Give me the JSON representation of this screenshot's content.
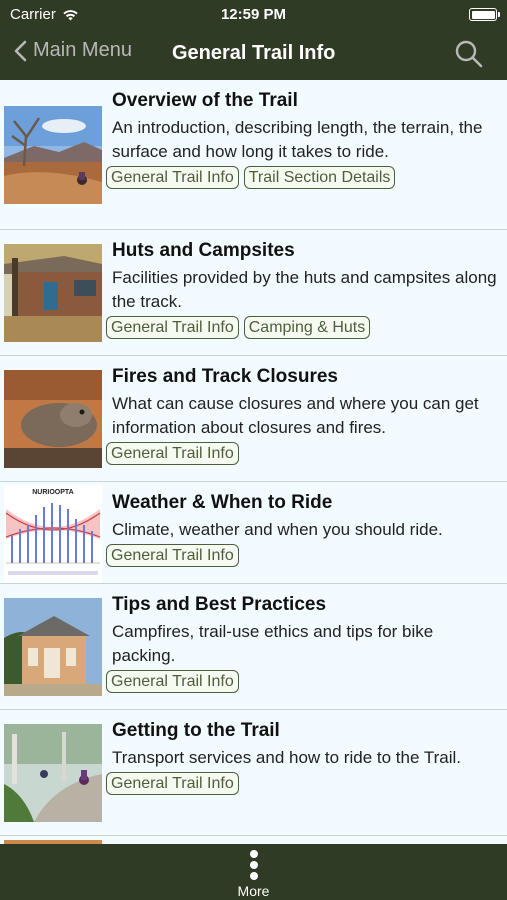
{
  "status_bar": {
    "carrier": "Carrier",
    "time": "12:59 PM"
  },
  "nav": {
    "back_label": "Main Menu",
    "title": "General Trail Info"
  },
  "items": [
    {
      "title": "Overview of the Trail",
      "description": "An introduction, describing length, the terrain, the surface and how long it takes to ride.",
      "tags": [
        "General Trail Info",
        "Trail Section Details"
      ]
    },
    {
      "title": "Huts and Campsites",
      "description": "Facilities provided by the huts and campsites along the track.",
      "tags": [
        "General Trail Info",
        "Camping & Huts"
      ]
    },
    {
      "title": "Fires and Track Closures",
      "description": "What can cause closures and where you can get information about closures and fires.",
      "tags": [
        "General Trail Info"
      ]
    },
    {
      "title": "Weather & When to Ride",
      "description": "Climate, weather and when you should ride.",
      "tags": [
        "General Trail Info"
      ],
      "thumb_label": "NURIOOPTA"
    },
    {
      "title": "Tips and Best Practices",
      "description": "Campfires, trail-use ethics and tips for bike packing.",
      "tags": [
        "General Trail Info"
      ]
    },
    {
      "title": "Getting to the Trail",
      "description": "Transport services and how to ride to the Trail.",
      "tags": [
        "General Trail Info"
      ]
    }
  ],
  "tab_bar": {
    "more_label": "More"
  },
  "colors": {
    "header": "#2f3b24",
    "tag": "#4e5e3c",
    "background": "#f2fbff"
  }
}
